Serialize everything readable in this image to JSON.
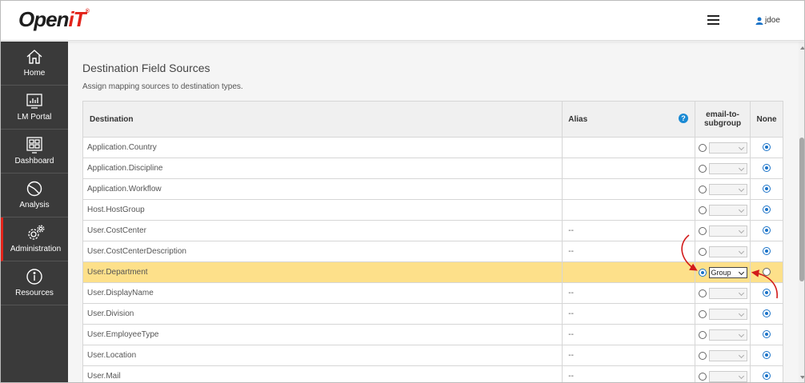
{
  "header": {
    "logo_text": "Open",
    "logo_accent": "iT",
    "logo_reg": "®",
    "user_name": "jdoe"
  },
  "sidebar": {
    "items": [
      {
        "label": "Home",
        "icon": "home-icon"
      },
      {
        "label": "LM Portal",
        "icon": "lm-portal-icon"
      },
      {
        "label": "Dashboard",
        "icon": "dashboard-icon"
      },
      {
        "label": "Analysis",
        "icon": "analysis-icon"
      },
      {
        "label": "Administration",
        "icon": "gears-icon",
        "active": true
      },
      {
        "label": "Resources",
        "icon": "info-icon"
      }
    ]
  },
  "page": {
    "title": "Destination Field Sources",
    "subtitle": "Assign mapping sources to destination types."
  },
  "table": {
    "headers": {
      "destination": "Destination",
      "alias": "Alias",
      "help": "?",
      "email_line1": "email-to-",
      "email_line2": "subgroup",
      "none": "None"
    },
    "rows": [
      {
        "destination": "Application.Country",
        "alias": "",
        "select": "",
        "email_selected": false
      },
      {
        "destination": "Application.Discipline",
        "alias": "",
        "select": "",
        "email_selected": false
      },
      {
        "destination": "Application.Workflow",
        "alias": "",
        "select": "",
        "email_selected": false
      },
      {
        "destination": "Host.HostGroup",
        "alias": "",
        "select": "",
        "email_selected": false
      },
      {
        "destination": "User.CostCenter",
        "alias": "--",
        "select": "",
        "email_selected": false
      },
      {
        "destination": "User.CostCenterDescription",
        "alias": "--",
        "select": "",
        "email_selected": false
      },
      {
        "destination": "User.Department",
        "alias": "",
        "select": "Group",
        "email_selected": true,
        "highlight": true
      },
      {
        "destination": "User.DisplayName",
        "alias": "--",
        "select": "",
        "email_selected": false
      },
      {
        "destination": "User.Division",
        "alias": "--",
        "select": "",
        "email_selected": false
      },
      {
        "destination": "User.EmployeeType",
        "alias": "--",
        "select": "",
        "email_selected": false
      },
      {
        "destination": "User.Location",
        "alias": "--",
        "select": "",
        "email_selected": false
      },
      {
        "destination": "User.Mail",
        "alias": "--",
        "select": "",
        "email_selected": false
      }
    ]
  },
  "colors": {
    "sidebar_bg": "#3a3a3a",
    "accent_red": "#e2231a",
    "highlight_row": "#fde08a",
    "radio_blue": "#1a73c8",
    "help_blue": "#1a8ad4",
    "annotation_arrow": "#d21a1a"
  }
}
